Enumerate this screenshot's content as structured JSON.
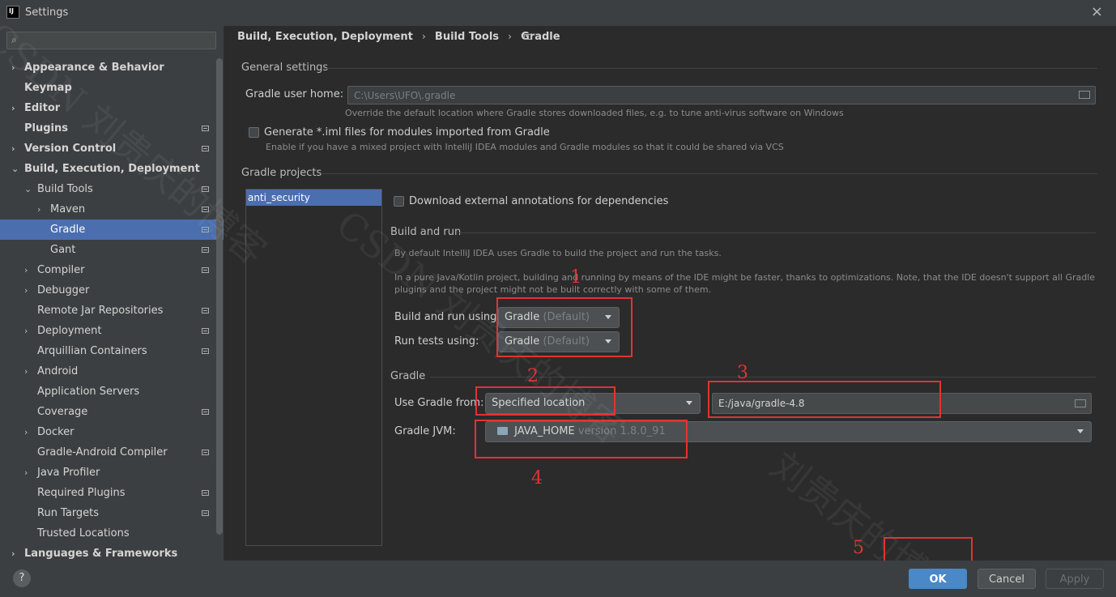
{
  "window": {
    "title": "Settings",
    "logo_text": "IJ"
  },
  "icons": {
    "close": "×",
    "search": "⌕",
    "folder": "folder-icon",
    "help": "?"
  },
  "sidebar": {
    "items": [
      {
        "label": "Appearance & Behavior",
        "bold": true,
        "arrow": "›",
        "indent": 0,
        "marker": false
      },
      {
        "label": "Keymap",
        "bold": true,
        "arrow": "",
        "indent": 0,
        "marker": false
      },
      {
        "label": "Editor",
        "bold": true,
        "arrow": "›",
        "indent": 0,
        "marker": false
      },
      {
        "label": "Plugins",
        "bold": true,
        "arrow": "",
        "indent": 0,
        "marker": true
      },
      {
        "label": "Version Control",
        "bold": true,
        "arrow": "›",
        "indent": 0,
        "marker": true
      },
      {
        "label": "Build, Execution, Deployment",
        "bold": true,
        "arrow": "⌄",
        "indent": 0,
        "marker": false
      },
      {
        "label": "Build Tools",
        "bold": false,
        "arrow": "⌄",
        "indent": 1,
        "marker": true
      },
      {
        "label": "Maven",
        "bold": false,
        "arrow": "›",
        "indent": 2,
        "marker": true
      },
      {
        "label": "Gradle",
        "bold": false,
        "arrow": "",
        "indent": 2,
        "marker": true,
        "selected": true
      },
      {
        "label": "Gant",
        "bold": false,
        "arrow": "",
        "indent": 2,
        "marker": true
      },
      {
        "label": "Compiler",
        "bold": false,
        "arrow": "›",
        "indent": 1,
        "marker": true
      },
      {
        "label": "Debugger",
        "bold": false,
        "arrow": "›",
        "indent": 1,
        "marker": false
      },
      {
        "label": "Remote Jar Repositories",
        "bold": false,
        "arrow": "",
        "indent": 1,
        "marker": true
      },
      {
        "label": "Deployment",
        "bold": false,
        "arrow": "›",
        "indent": 1,
        "marker": true
      },
      {
        "label": "Arquillian Containers",
        "bold": false,
        "arrow": "",
        "indent": 1,
        "marker": true
      },
      {
        "label": "Android",
        "bold": false,
        "arrow": "›",
        "indent": 1,
        "marker": false
      },
      {
        "label": "Application Servers",
        "bold": false,
        "arrow": "",
        "indent": 1,
        "marker": false
      },
      {
        "label": "Coverage",
        "bold": false,
        "arrow": "",
        "indent": 1,
        "marker": true
      },
      {
        "label": "Docker",
        "bold": false,
        "arrow": "›",
        "indent": 1,
        "marker": false
      },
      {
        "label": "Gradle-Android Compiler",
        "bold": false,
        "arrow": "",
        "indent": 1,
        "marker": true
      },
      {
        "label": "Java Profiler",
        "bold": false,
        "arrow": "›",
        "indent": 1,
        "marker": false
      },
      {
        "label": "Required Plugins",
        "bold": false,
        "arrow": "",
        "indent": 1,
        "marker": true
      },
      {
        "label": "Run Targets",
        "bold": false,
        "arrow": "",
        "indent": 1,
        "marker": true
      },
      {
        "label": "Trusted Locations",
        "bold": false,
        "arrow": "",
        "indent": 1,
        "marker": false
      },
      {
        "label": "Languages & Frameworks",
        "bold": true,
        "arrow": "›",
        "indent": 0,
        "marker": false
      }
    ]
  },
  "breadcrumb": {
    "part1": "Build, Execution, Deployment",
    "part2": "Build Tools",
    "part3": "Gradle",
    "sep": "›"
  },
  "general": {
    "title": "General settings",
    "user_home_label": "Gradle user home:",
    "user_home_value": "C:\\Users\\UFO\\.gradle",
    "user_home_hint": "Override the default location where Gradle stores downloaded files, e.g. to tune anti-virus software on Windows",
    "iml_label": "Generate *.iml files for modules imported from Gradle",
    "iml_hint": "Enable if you have a mixed project with IntelliJ IDEA modules and Gradle modules so that it could be shared via VCS"
  },
  "projects": {
    "title": "Gradle projects",
    "list": [
      "anti_security"
    ],
    "download_annotations_label": "Download external annotations for dependencies"
  },
  "build_run": {
    "title": "Build and run",
    "hint1": "By default IntelliJ IDEA uses Gradle to build the project and run the tasks.",
    "hint2_line1": "In a pure Java/Kotlin project, building and running by means of the IDE might be faster, thanks to optimizations. Note, that the IDE doesn't support all Gradle",
    "hint2_line2": "plugins and the project might not be built correctly with some of them.",
    "build_using_label": "Build and run using:",
    "build_using_value": "Gradle",
    "build_using_suffix": "(Default)",
    "tests_using_label": "Run tests using:",
    "tests_using_value": "Gradle",
    "tests_using_suffix": "(Default)"
  },
  "gradle": {
    "title": "Gradle",
    "use_from_label": "Use Gradle from:",
    "use_from_value": "Specified location",
    "location_value": "E:/java/gradle-4.8",
    "jvm_label": "Gradle JVM:",
    "jvm_value": "JAVA_HOME",
    "jvm_version": "version 1.8.0_91"
  },
  "annotations": {
    "n1": "1",
    "n2": "2",
    "n3": "3",
    "n4": "4",
    "n5": "5"
  },
  "watermark": {
    "w1": "CSDN 刘贵庆的博客",
    "w2": "CSDN 刘贵庆的博客",
    "w3": "刘贵庆的博"
  },
  "buttons": {
    "ok": "OK",
    "cancel": "Cancel",
    "apply": "Apply"
  }
}
